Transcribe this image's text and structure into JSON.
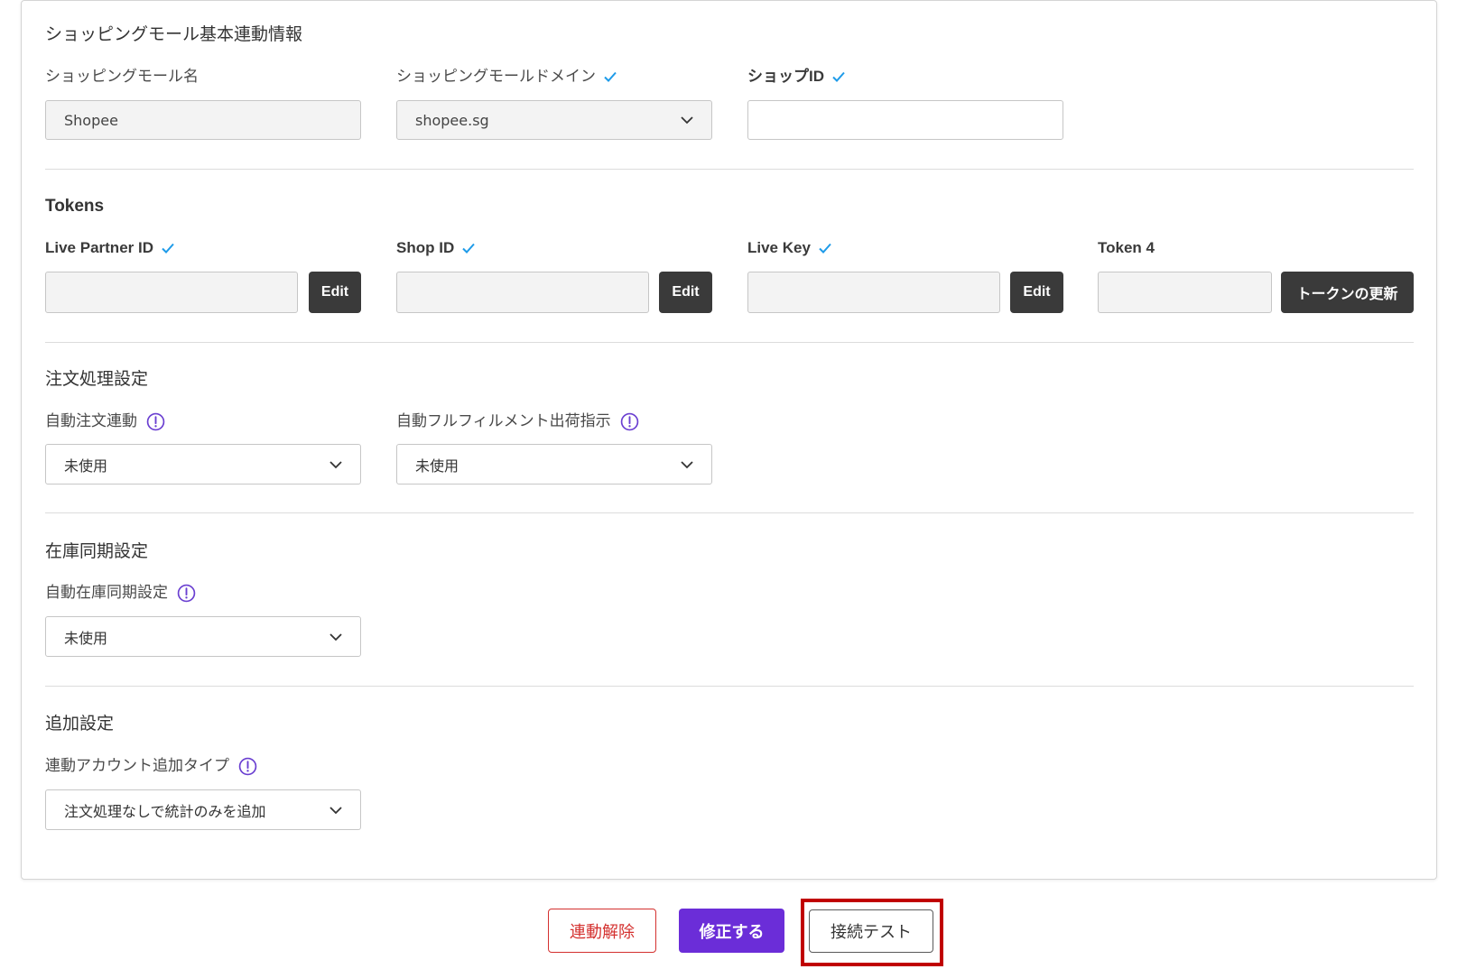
{
  "basic_section": {
    "title": "ショッピングモール基本連動情報",
    "mall_name": {
      "label": "ショッピングモール名",
      "value": "Shopee"
    },
    "mall_domain": {
      "label": "ショッピングモールドメイン",
      "value": "shopee.sg",
      "verified": true
    },
    "shop_id": {
      "label": "ショップID",
      "verified": true
    }
  },
  "tokens_section": {
    "title": "Tokens",
    "fields": [
      {
        "label": "Live Partner ID",
        "verified": true,
        "button": "Edit"
      },
      {
        "label": "Shop ID",
        "verified": true,
        "button": "Edit"
      },
      {
        "label": "Live Key",
        "verified": true,
        "button": "Edit"
      },
      {
        "label": "Token 4",
        "verified": false,
        "button": "トークンの更新"
      }
    ]
  },
  "order_section": {
    "title": "注文処理設定",
    "auto_order_sync": {
      "label": "自動注文連動",
      "value": "未使用"
    },
    "auto_fulfillment": {
      "label": "自動フルフィルメント出荷指示",
      "value": "未使用"
    }
  },
  "inventory_section": {
    "title": "在庫同期設定",
    "auto_inventory_sync": {
      "label": "自動在庫同期設定",
      "value": "未使用"
    }
  },
  "additional_section": {
    "title": "追加設定",
    "account_add_type": {
      "label": "連動アカウント追加タイプ",
      "value": "注文処理なしで統計のみを追加"
    }
  },
  "footer": {
    "unlink_button": "連動解除",
    "modify_button": "修正する",
    "connection_test_button": "接続テスト"
  },
  "icons": {
    "verified": "check-icon",
    "help": "info-icon",
    "dropdown": "chevron-down-icon"
  },
  "colors": {
    "accent": "#6b2dd8",
    "verified_check": "#1e9be9",
    "info_icon": "#6a3fd1",
    "danger": "#d4312f",
    "highlight": "#c00000",
    "dark_button": "#3a3a3a"
  }
}
